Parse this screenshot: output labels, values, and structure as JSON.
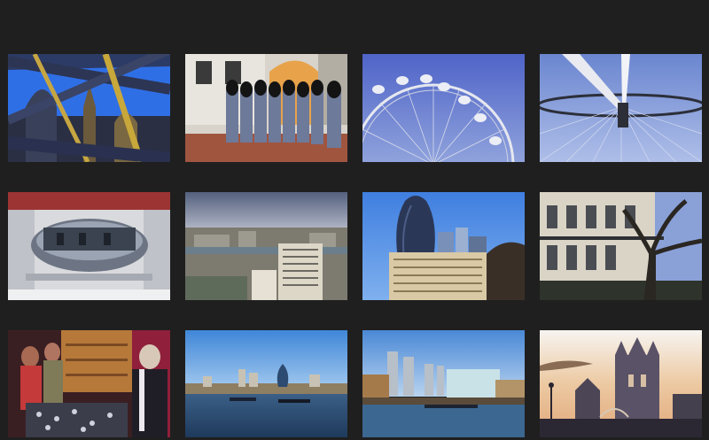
{
  "gallery": {
    "items": [
      {
        "subject": "tower-bridge-steelwork-photo"
      },
      {
        "subject": "royal-guards-photo"
      },
      {
        "subject": "london-eye-wheel-photo"
      },
      {
        "subject": "london-eye-spokes-photo"
      },
      {
        "subject": "london-eye-capsule-photo"
      },
      {
        "subject": "city-skyline-aerial-photo"
      },
      {
        "subject": "gherkin-tower-photo"
      },
      {
        "subject": "terraced-houses-photo"
      },
      {
        "subject": "market-stall-photo"
      },
      {
        "subject": "thames-skyline-photo"
      },
      {
        "subject": "canary-wharf-riverside-photo"
      },
      {
        "subject": "tower-bridge-sunset-photo"
      }
    ]
  },
  "colors": {
    "background": "#1f1f1f",
    "sky_blue": "#3d7fe0",
    "dusk_orange": "#e9b98a"
  }
}
